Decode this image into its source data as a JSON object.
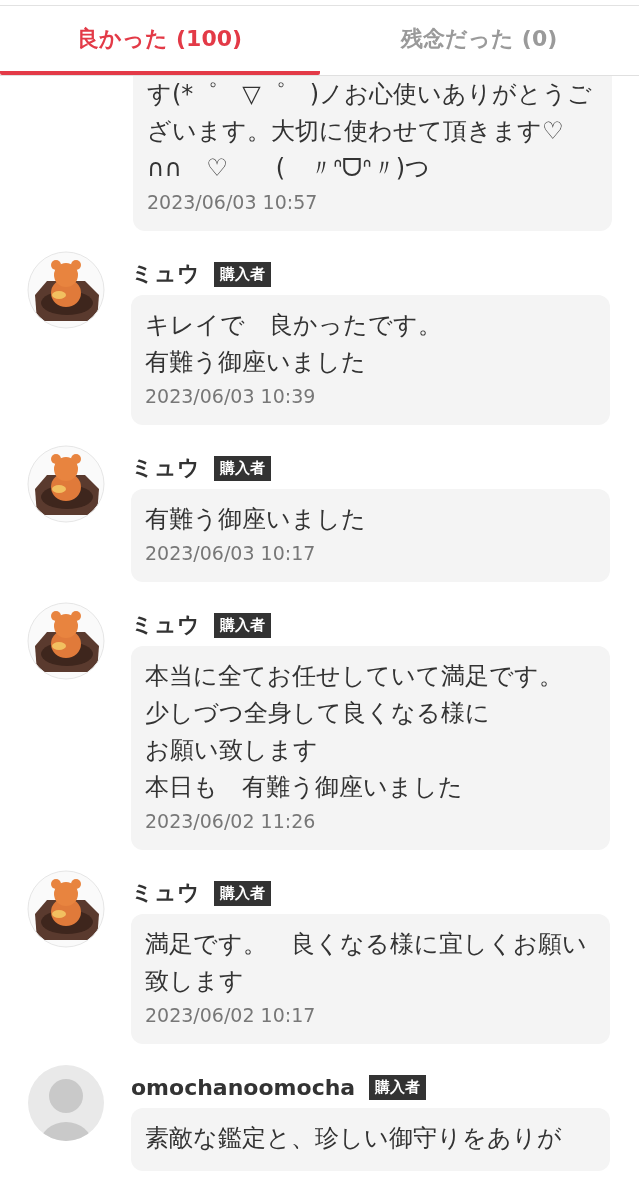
{
  "tabs": [
    {
      "label": "良かった (100)",
      "selected": true
    },
    {
      "label": "残念だった (0)",
      "selected": false
    }
  ],
  "reviews": [
    {
      "kind": "partial",
      "lines": [
        "す(*゜　▽゜　)ノお心使いありがとうございます。大切に使わせて頂きます♡",
        "∩∩　♡　　(　〃ᐢᗜᐢ〃)つ"
      ],
      "date": "2023/06/03 10:57"
    },
    {
      "kind": "full",
      "avatar": {
        "kind": "picture"
      },
      "name": "ミュウ",
      "badge": "購入者",
      "lines": [
        "キレイで　良かったです。",
        "有難う御座いました"
      ],
      "date": "2023/06/03 10:39"
    },
    {
      "kind": "full",
      "avatar": {
        "kind": "picture"
      },
      "name": "ミュウ",
      "badge": "購入者",
      "lines": [
        "有難う御座いました"
      ],
      "date": "2023/06/03 10:17"
    },
    {
      "kind": "full",
      "avatar": {
        "kind": "picture"
      },
      "name": "ミュウ",
      "badge": "購入者",
      "lines": [
        "本当に全てお任せしていて満足です。",
        "少しづつ全身して良くなる様に",
        "お願い致します",
        "本日も　有難う御座いました"
      ],
      "date": "2023/06/02 11:26"
    },
    {
      "kind": "full",
      "avatar": {
        "kind": "picture"
      },
      "name": "ミュウ",
      "badge": "購入者",
      "lines": [
        "満足です。　良くなる様に宜しくお願い致します"
      ],
      "date": "2023/06/02 10:17"
    },
    {
      "kind": "full",
      "avatar": {
        "kind": "default"
      },
      "name": "omochanoomocha",
      "badge": "購入者",
      "lines": [
        "素敵な鑑定と、珍しい御守りをありが"
      ]
    }
  ]
}
